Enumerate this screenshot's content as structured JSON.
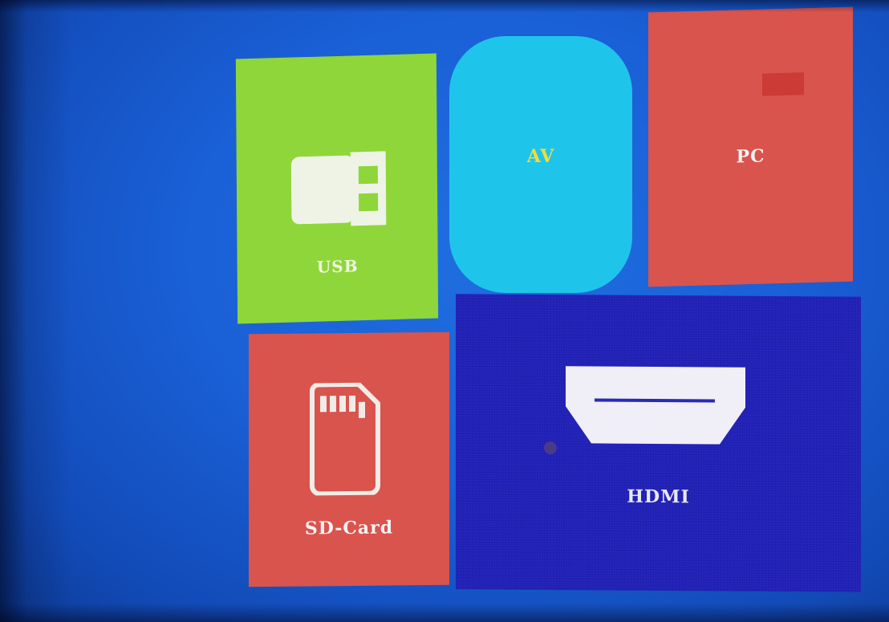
{
  "screen": {
    "sources": {
      "usb": {
        "label": "USB",
        "icon": "usb-drive-icon",
        "color": "#8fd63a"
      },
      "av": {
        "label": "AV",
        "color": "#1fc4ea",
        "label_color": "#f4dc3a"
      },
      "pc": {
        "label": "PC",
        "color": "#d9544d"
      },
      "sd": {
        "label": "SD-Card",
        "icon": "sd-card-icon",
        "color": "#d9544d"
      },
      "hdmi": {
        "label": "HDMI",
        "icon": "hdmi-port-icon",
        "color": "#2020b8"
      }
    },
    "background_color": "#1a5fd6"
  }
}
